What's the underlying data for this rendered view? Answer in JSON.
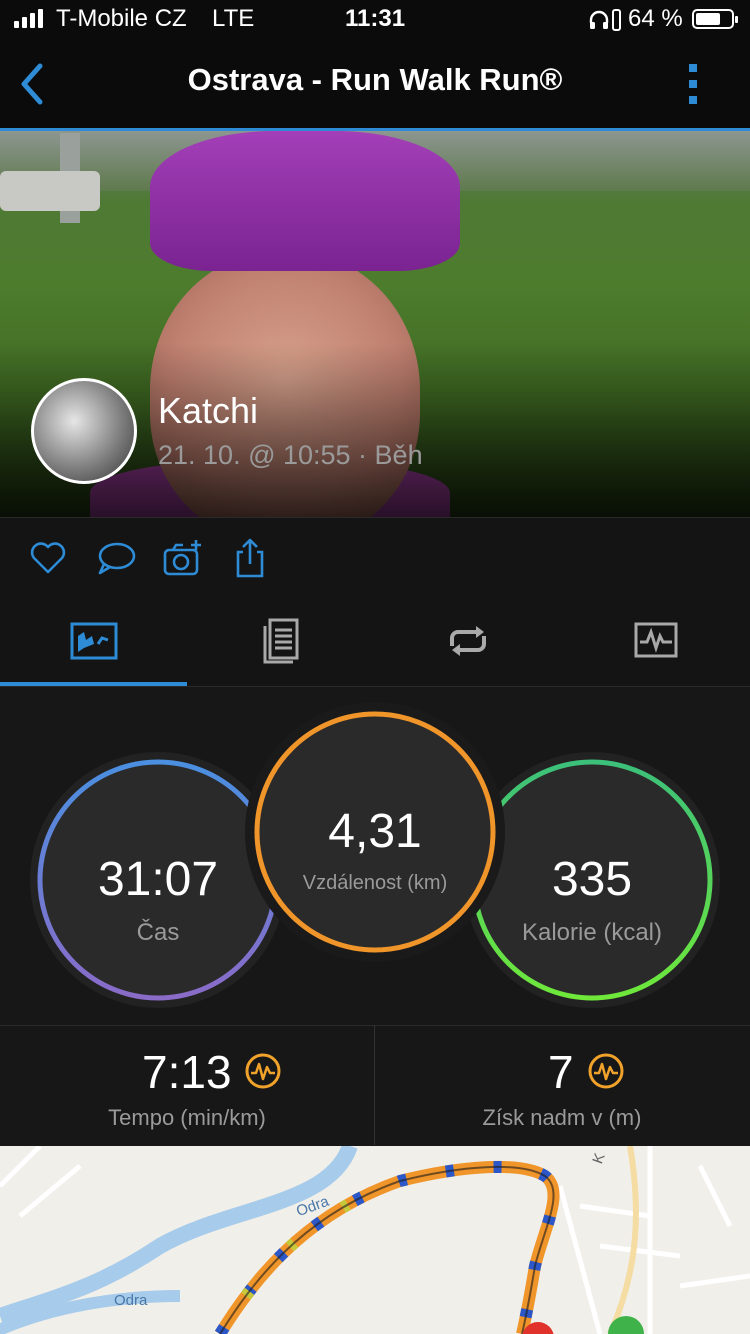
{
  "status_bar": {
    "carrier": "T-Mobile CZ",
    "network": "LTE",
    "time": "11:31",
    "battery": "64 %"
  },
  "header": {
    "title": "Ostrava - Run Walk Run®",
    "back_icon": "chevron-left-icon",
    "menu_icon": "more-vertical-icon"
  },
  "activity": {
    "user_name": "Katchi",
    "meta": "21. 10. @ 10:55 · Běh"
  },
  "actions": [
    "heart-icon",
    "comment-icon",
    "add-photo-icon",
    "share-icon"
  ],
  "tabs": [
    {
      "icon": "overview-icon",
      "active": true
    },
    {
      "icon": "details-list-icon",
      "active": false
    },
    {
      "icon": "laps-icon",
      "active": false
    },
    {
      "icon": "chart-icon",
      "active": false
    }
  ],
  "stats": {
    "time": {
      "value": "31:07",
      "label": "Čas"
    },
    "distance": {
      "value": "4,31",
      "label": "Vzdálenost (km)"
    },
    "calories": {
      "value": "335",
      "label": "Kalorie (kcal)"
    }
  },
  "secondary": {
    "pace": {
      "value": "7:13",
      "label": "Tempo (min/km)"
    },
    "elevation": {
      "value": "7",
      "label": "Získ nadm v (m)"
    }
  },
  "map": {
    "river_labels": [
      "Odra",
      "Odra"
    ],
    "street_label": "K"
  },
  "colors": {
    "accent": "#2e8bd6",
    "time_ring": "#4a8fe0",
    "distance_ring": "#f0952a",
    "calories_ring": "#4cd04c",
    "badge": "#f0a22a"
  }
}
